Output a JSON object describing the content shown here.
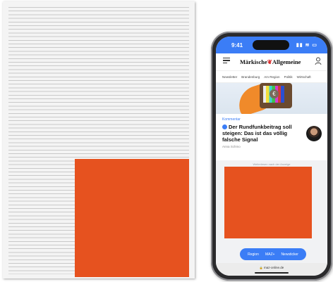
{
  "phone": {
    "time": "9:41",
    "status_icons": "▮▮ ≋ ▭",
    "logo_part1": "Märkische",
    "logo_eagle": "❦",
    "logo_part2": "Allgemeine",
    "nav_items": [
      "Newsletter",
      "Brandenburg",
      "Am Region",
      "Politik",
      "Wirtschaft"
    ],
    "hero_coin": "€",
    "article": {
      "kicker": "Kommentar",
      "headline": "Der Rundfunkbeitrag soll steigen: Das ist das völlig falsche Signal",
      "author": "Anna Schmo"
    },
    "ad_label": "Weiterlesen nach der Anzeige",
    "pill_items": [
      "Region",
      "MAZ+",
      "Newsticker"
    ],
    "url": "maz-online.de"
  },
  "colors": {
    "accent": "#3b7df6",
    "ad_orange": "#e6521f"
  }
}
